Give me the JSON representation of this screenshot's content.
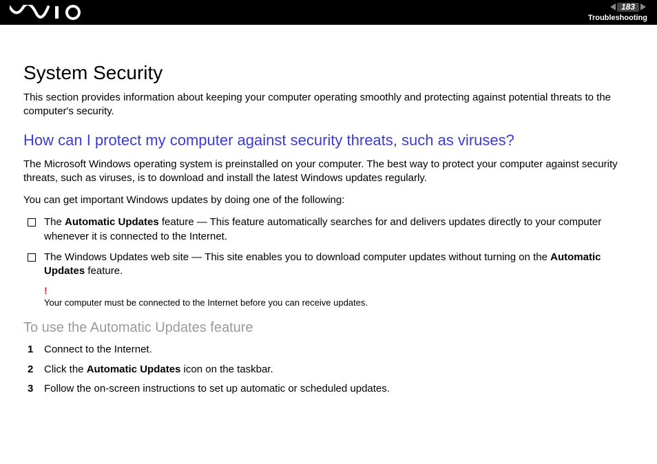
{
  "header": {
    "page_number": "183",
    "section": "Troubleshooting"
  },
  "page": {
    "title": "System Security",
    "intro": "This section provides information about keeping your computer operating smoothly and protecting against potential threats to the computer's security.",
    "question": "How can I protect my computer against security threats, such as viruses?",
    "para1": "The Microsoft Windows operating system is preinstalled on your computer. The best way to protect your computer against security threats, such as viruses, is to download and install the latest Windows updates regularly.",
    "para2": "You can get important Windows updates by doing one of the following:",
    "bullet1_pre": "The ",
    "bullet1_bold": "Automatic Updates",
    "bullet1_post": " feature — This feature automatically searches for and delivers updates directly to your computer whenever it is connected to the Internet.",
    "bullet2_pre": "The Windows Updates web site — This site enables you to download computer updates without turning on the ",
    "bullet2_bold": "Automatic Updates",
    "bullet2_post": " feature.",
    "note_mark": "!",
    "note_text": "Your computer must be connected to the Internet before you can receive updates.",
    "subheading": "To use the Automatic Updates feature",
    "step1": "Connect to the Internet.",
    "step2_pre": "Click the ",
    "step2_bold": "Automatic Updates",
    "step2_post": " icon on the taskbar.",
    "step3": "Follow the on-screen instructions to set up automatic or scheduled updates."
  }
}
